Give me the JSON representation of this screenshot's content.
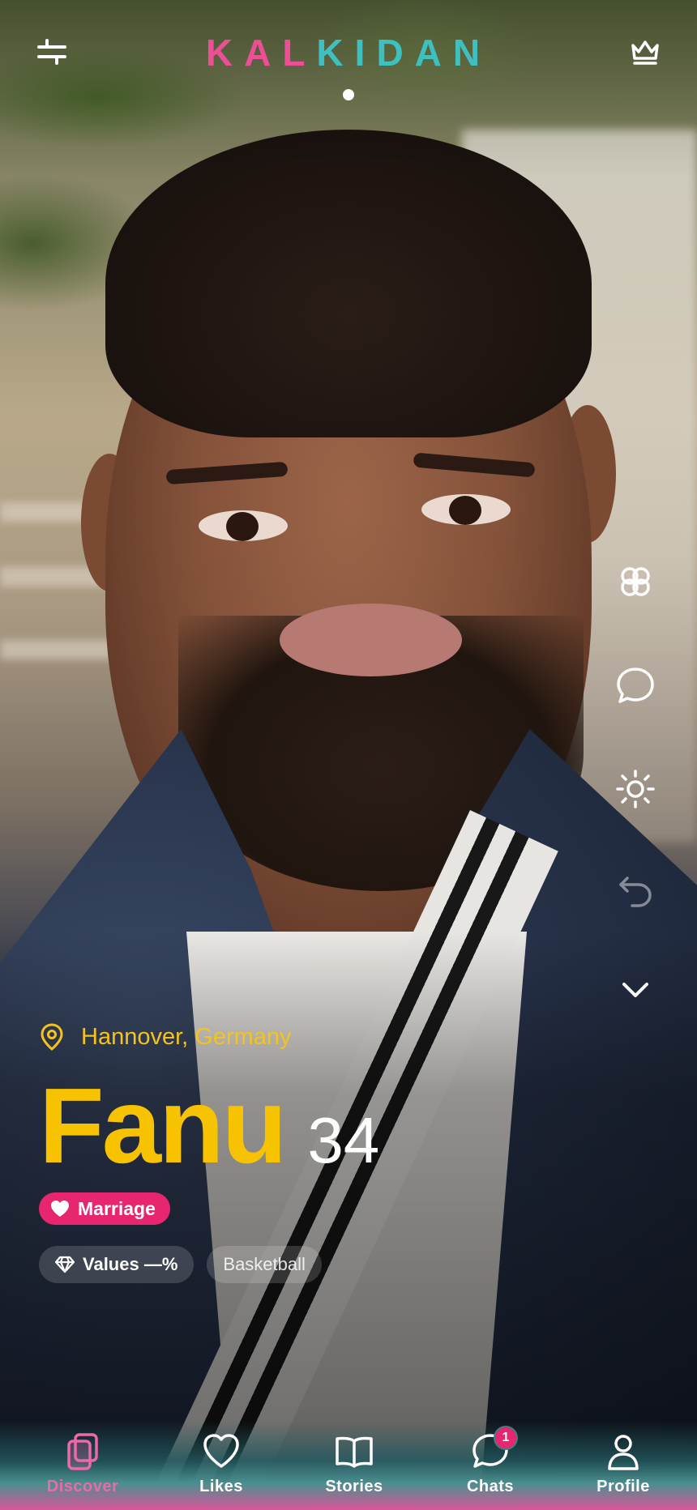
{
  "app": {
    "logo_letters": [
      {
        "ch": "K",
        "color": "#ec4f96"
      },
      {
        "ch": "A",
        "color": "#ec4f96"
      },
      {
        "ch": "L",
        "color": "#ec4f96"
      },
      {
        "ch": "K",
        "color": "#3ec0c0"
      },
      {
        "ch": "I",
        "color": "#3ec0c0"
      },
      {
        "ch": "D",
        "color": "#3ec0c0"
      },
      {
        "ch": "A",
        "color": "#3ec0c0"
      },
      {
        "ch": "N",
        "color": "#3ec0c0"
      }
    ]
  },
  "header": {
    "filter_icon": "filter-sliders-icon",
    "premium_icon": "crown-icon"
  },
  "side_actions": [
    {
      "name": "flower-icon"
    },
    {
      "name": "chat-bubble-icon"
    },
    {
      "name": "sun-icon"
    },
    {
      "name": "undo-icon"
    },
    {
      "name": "chevron-down-icon"
    }
  ],
  "profile": {
    "location": "Hannover, Germany",
    "name": "Fanu",
    "age": "34",
    "intent": "Marriage",
    "chips": [
      {
        "label": "Values —%",
        "icon": "diamond-icon"
      },
      {
        "label": "Basketball"
      }
    ]
  },
  "tabs": [
    {
      "id": "discover",
      "label": "Discover",
      "icon": "cards-icon",
      "active": true
    },
    {
      "id": "likes",
      "label": "Likes",
      "icon": "heart-icon"
    },
    {
      "id": "stories",
      "label": "Stories",
      "icon": "book-icon"
    },
    {
      "id": "chats",
      "label": "Chats",
      "icon": "chat-icon",
      "badge": "1"
    },
    {
      "id": "profile",
      "label": "Profile",
      "icon": "person-icon"
    }
  ],
  "colors": {
    "accent_yellow": "#f7c200",
    "accent_pink": "#e8266f",
    "logo_pink": "#ec4f96",
    "logo_teal": "#3ec0c0"
  }
}
